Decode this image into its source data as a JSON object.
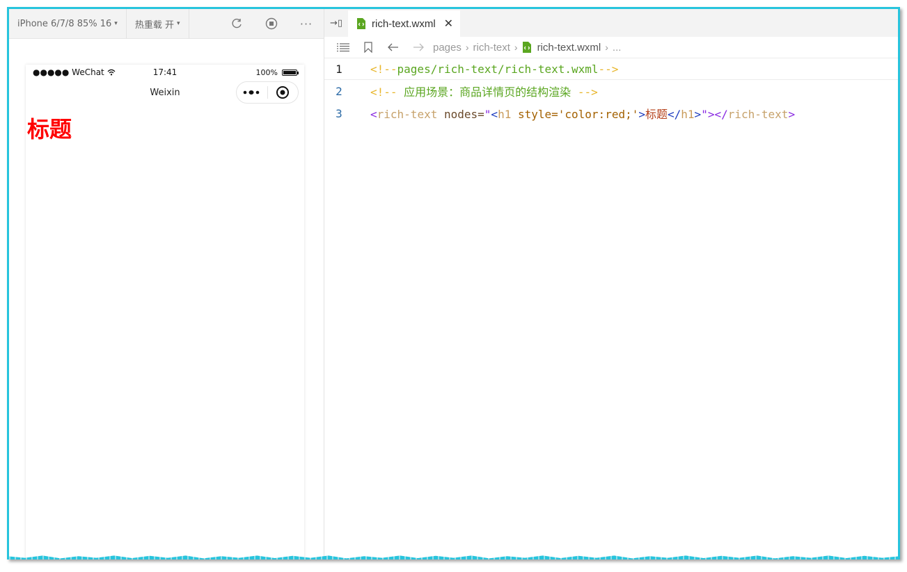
{
  "simulator": {
    "device_label": "iPhone 6/7/8 85% 16",
    "hot_reload_label": "热重载 开",
    "status": {
      "carrier": "●●●●● WeChat",
      "time": "17:41",
      "battery": "100%"
    },
    "nav_title": "Weixin",
    "content_heading": "标题",
    "heading_color": "#ff0000"
  },
  "editor": {
    "tab_label": "rich-text.wxml",
    "breadcrumb": {
      "part1": "pages",
      "part2": "rich-text",
      "file": "rich-text.wxml",
      "ellipsis": "..."
    },
    "lines": {
      "n1": "1",
      "n2": "2",
      "n3": "3",
      "l1_open": "<!--",
      "l1_text": "pages/rich-text/rich-text.wxml",
      "l1_close": "-->",
      "l2_open": "<!-- ",
      "l2_text": "应用场景：商品详情页的结构渲染",
      "l2_close": " -->",
      "l3_lt": "<",
      "l3_tag": "rich-text",
      "l3_attr": " nodes=",
      "l3_q1": "\"",
      "l3_h1_lt": "<",
      "l3_h1": "h1",
      "l3_style": " style='color:red;'",
      "l3_h1_gt": ">",
      "l3_text": "标题",
      "l3_h1c_lt": "</",
      "l3_h1c": "h1",
      "l3_h1c_gt": ">",
      "l3_q2": "\"",
      "l3_gt": ">",
      "l3_close_lt": "</",
      "l3_close_tag": "rich-text",
      "l3_close_gt": ">"
    }
  },
  "colors": {
    "frame_border": "#27c4dd",
    "accent_green": "#5aa620"
  }
}
